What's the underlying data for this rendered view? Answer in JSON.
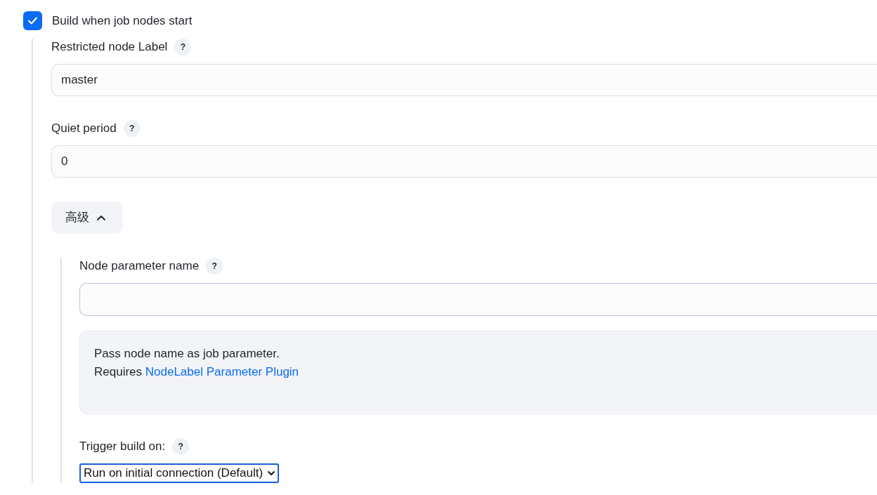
{
  "build_trigger": {
    "label": "Build when job nodes start",
    "checked": true
  },
  "fields": [
    {
      "label": "Restricted node Label",
      "help": "?",
      "value": "master"
    },
    {
      "label": "Quiet period",
      "help": "?",
      "value": "0"
    }
  ],
  "advanced_toggle": {
    "label": "高级",
    "expanded": true
  },
  "advanced": {
    "fields": [
      {
        "label": "Node parameter name",
        "help": "?"
      }
    ],
    "help_box": {
      "text": "Pass node name as job parameter.",
      "prefix": "Requires",
      "link": "NodeLabel Parameter Plugin"
    },
    "trigger": {
      "label": "Trigger build on:",
      "help": "?",
      "value": "Run on initial connection (Default)"
    }
  }
}
